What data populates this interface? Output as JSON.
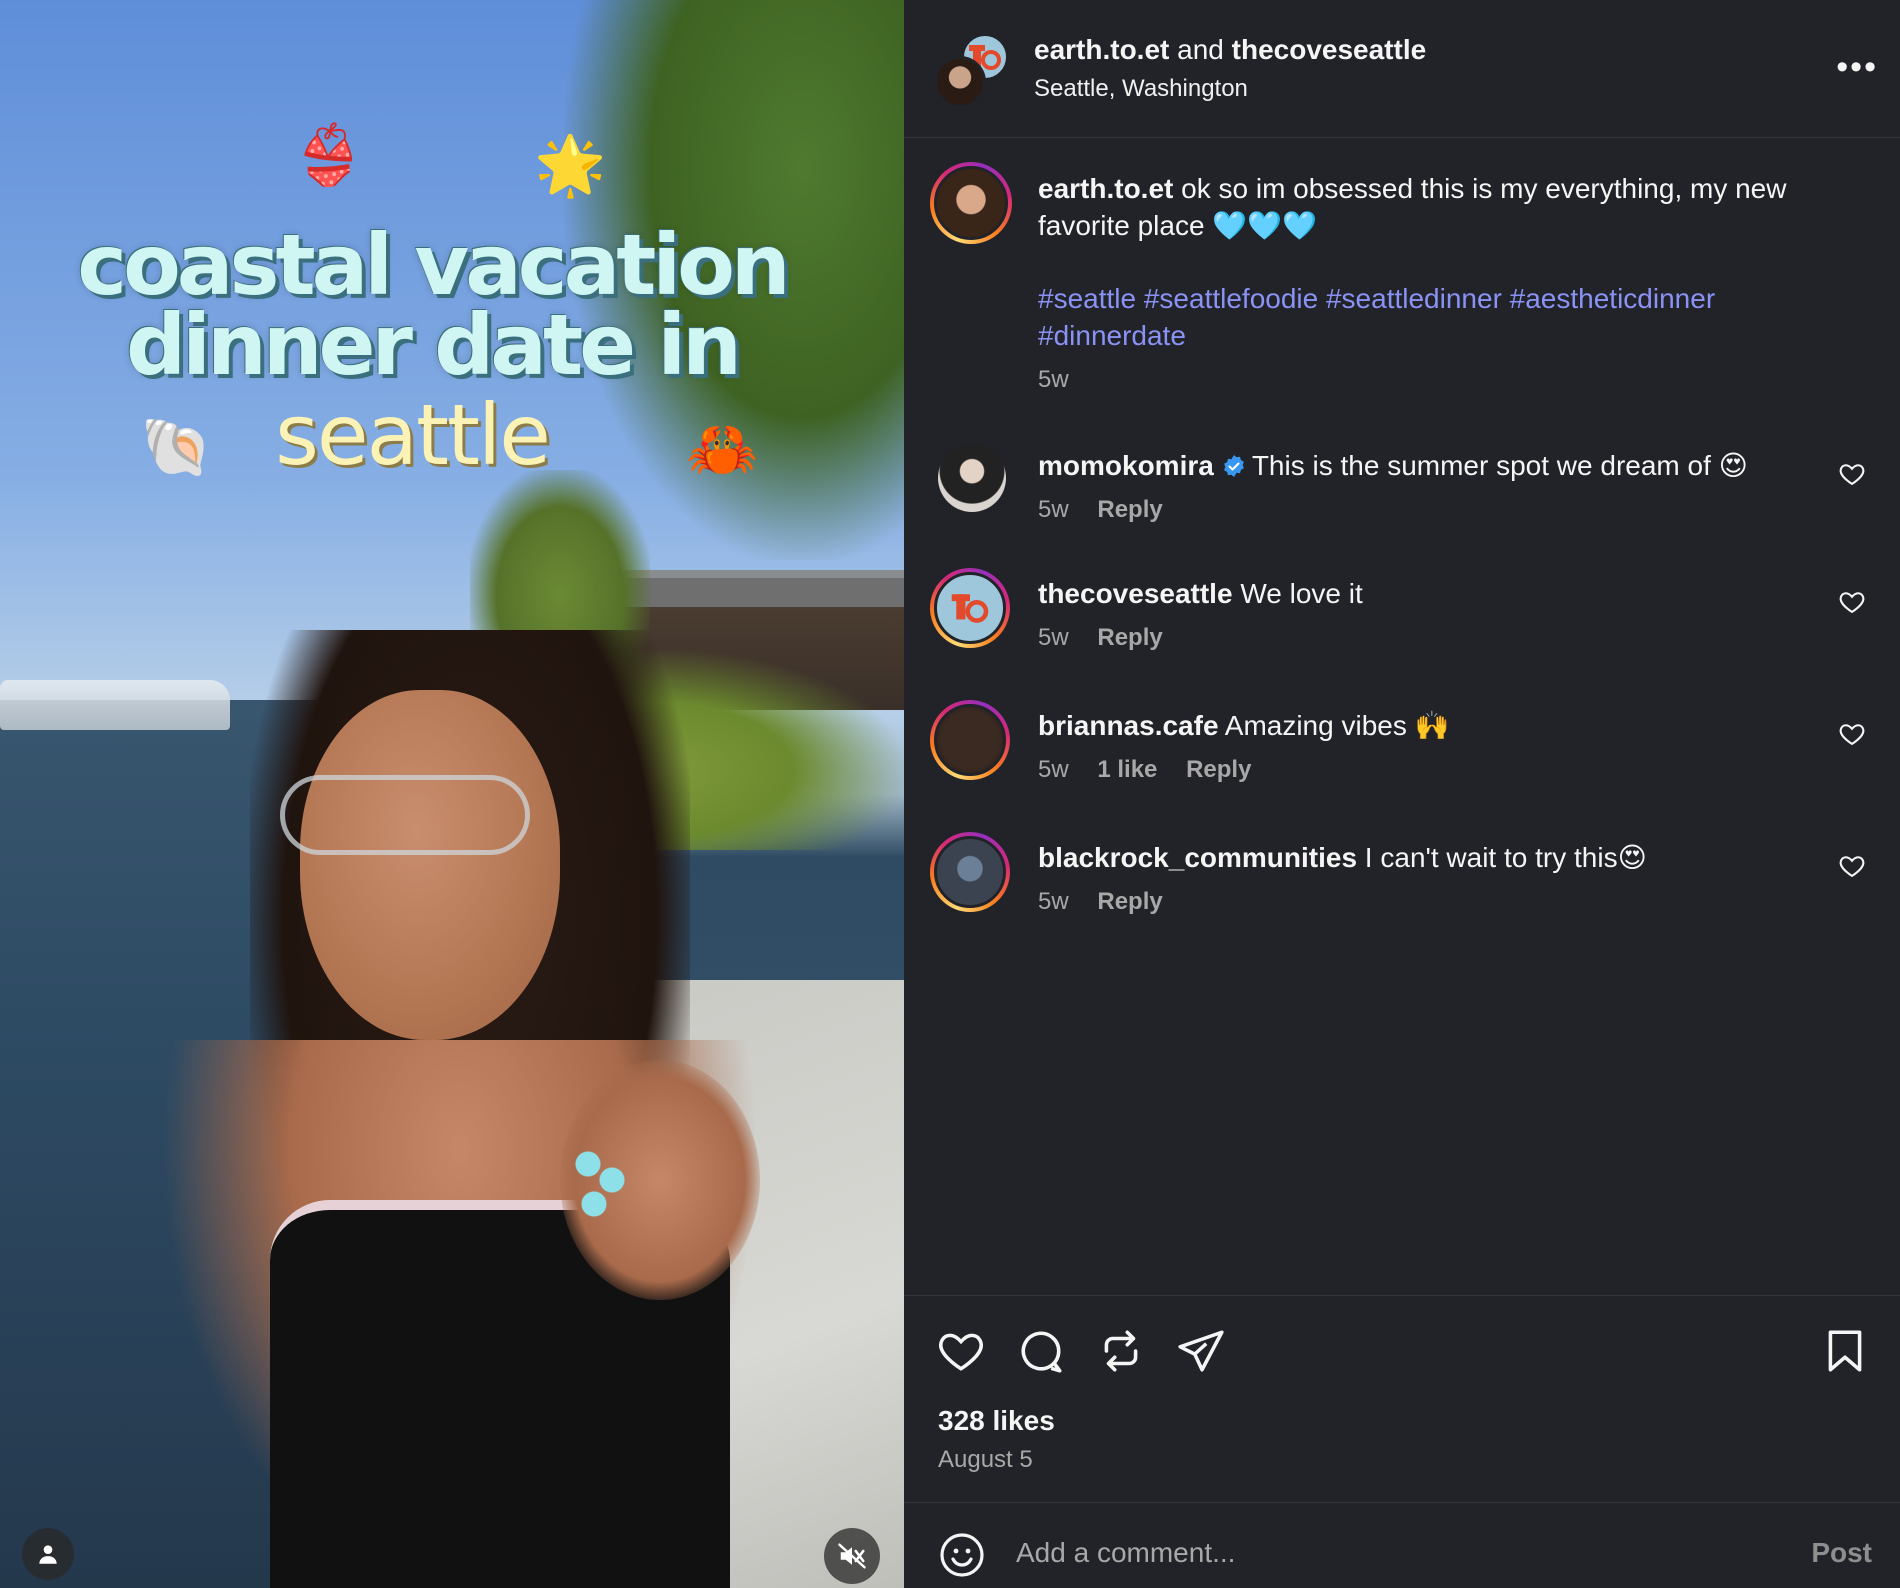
{
  "media": {
    "overlay": {
      "line1": "coastal vacation",
      "line2": "dinner date in",
      "line3": "seattle"
    },
    "stickers": {
      "bikini": "👙",
      "star": "🌟",
      "shell": "🐚",
      "crab": "🦀"
    },
    "icons": {
      "profile": "person-icon",
      "mute": "speaker-muted-icon"
    }
  },
  "header": {
    "user1": "earth.to.et",
    "and": "and",
    "user2": "thecoveseattle",
    "location": "Seattle, Washington",
    "more": "•••"
  },
  "caption": {
    "username": "earth.to.et",
    "text": " ok so im obsessed this is my everything, my new favorite place 🩵🩵🩵",
    "hashtags": "#seattle #seattlefoodie #seattledinner #aestheticdinner #dinnerdate",
    "time": "5w"
  },
  "comments": [
    {
      "username": "momokomira",
      "verified": true,
      "text": "This is the summer spot we dream of 😍",
      "time": "5w",
      "likes": "",
      "reply": "Reply"
    },
    {
      "username": "thecoveseattle",
      "verified": false,
      "text": " We love it",
      "time": "5w",
      "likes": "",
      "reply": "Reply"
    },
    {
      "username": "briannas.cafe",
      "verified": false,
      "text": " Amazing vibes 🙌",
      "time": "5w",
      "likes": "1 like",
      "reply": "Reply"
    },
    {
      "username": "blackrock_communities",
      "verified": false,
      "text": " I can't wait to try this😍",
      "time": "5w",
      "likes": "",
      "reply": "Reply"
    }
  ],
  "footer": {
    "likes": "328 likes",
    "date": "August 5",
    "comment_placeholder": "Add a comment...",
    "post_label": "Post"
  },
  "colors": {
    "background": "#212328",
    "hashtag": "#8a93f5",
    "verified": "#3897f0",
    "muted_text": "#a8a8a8"
  }
}
